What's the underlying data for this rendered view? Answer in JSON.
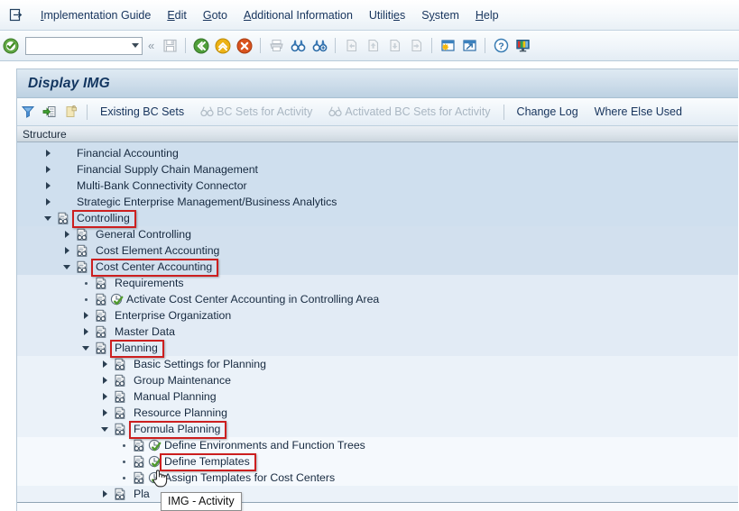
{
  "window": {
    "title": "Display IMG"
  },
  "menubar": {
    "system_icon": "sap-system-menu-icon",
    "items": [
      {
        "label": "Implementation Guide",
        "accel": "I"
      },
      {
        "label": "Edit",
        "accel": "E"
      },
      {
        "label": "Goto",
        "accel": "G"
      },
      {
        "label": "Additional Information",
        "accel": "A"
      },
      {
        "label": "Utilities",
        "accel": "e"
      },
      {
        "label": "System",
        "accel": "y"
      },
      {
        "label": "Help",
        "accel": "H"
      }
    ]
  },
  "toolbar": {
    "enter_icon": "green-check-enter-icon",
    "command_field": {
      "value": "",
      "placeholder": ""
    },
    "command_dropdown_icon": "chevron-down-icon",
    "collapse_icon": "double-chevron-left-icon",
    "buttons": [
      {
        "name": "save-button",
        "icon": "floppy-disk-icon",
        "enabled": false
      },
      {
        "name": "back-button",
        "icon": "green-back-arrow-icon",
        "enabled": true
      },
      {
        "name": "exit-button",
        "icon": "yellow-exit-up-arrow-icon",
        "enabled": true
      },
      {
        "name": "cancel-button",
        "icon": "red-cancel-x-icon",
        "enabled": true
      },
      {
        "name": "print-button",
        "icon": "printer-icon",
        "enabled": false
      },
      {
        "name": "find-button",
        "icon": "binoculars-icon",
        "enabled": true
      },
      {
        "name": "find-next-button",
        "icon": "binoculars-plus-icon",
        "enabled": true
      },
      {
        "name": "first-page-button",
        "icon": "page-first-icon",
        "enabled": false
      },
      {
        "name": "previous-page-button",
        "icon": "page-up-icon",
        "enabled": false
      },
      {
        "name": "next-page-button",
        "icon": "page-down-icon",
        "enabled": false
      },
      {
        "name": "last-page-button",
        "icon": "page-last-icon",
        "enabled": false
      },
      {
        "name": "create-session-button",
        "icon": "new-session-window-icon",
        "enabled": true
      },
      {
        "name": "create-shortcut-button",
        "icon": "shortcut-window-arrow-icon",
        "enabled": true
      },
      {
        "name": "help-button",
        "icon": "blue-question-help-icon",
        "enabled": true
      },
      {
        "name": "customize-layout-button",
        "icon": "local-layout-monitor-icon",
        "enabled": true
      }
    ]
  },
  "apptoolbar": {
    "icons": [
      {
        "name": "filter-funnel-button",
        "icon": "blue-funnel-icon",
        "enabled": true
      },
      {
        "name": "expand-node-button",
        "icon": "green-arrow-into-list-icon",
        "enabled": true
      },
      {
        "name": "note-button",
        "icon": "yellow-note-lock-icon",
        "enabled": false
      }
    ],
    "buttons": [
      {
        "label": "Existing BC Sets",
        "enabled": true
      },
      {
        "label": "BC Sets for Activity",
        "enabled": false,
        "icon": "bc-set-glasses-icon"
      },
      {
        "label": "Activated BC Sets for Activity",
        "enabled": false,
        "icon": "bc-set-glasses-icon"
      },
      {
        "label": "Change Log",
        "enabled": true
      },
      {
        "label": "Where Else Used",
        "enabled": true
      }
    ]
  },
  "tree": {
    "column_header": "Structure",
    "rows": [
      {
        "label": "Financial Accounting",
        "level": 1,
        "twisty": "right",
        "node_icon": "none",
        "activity_icon": "none",
        "highlight": false
      },
      {
        "label": "Financial Supply Chain Management",
        "level": 1,
        "twisty": "right",
        "node_icon": "none",
        "activity_icon": "none",
        "highlight": false
      },
      {
        "label": "Multi-Bank Connectivity Connector",
        "level": 1,
        "twisty": "right",
        "node_icon": "none",
        "activity_icon": "none",
        "highlight": false
      },
      {
        "label": "Strategic Enterprise Management/Business Analytics",
        "level": 1,
        "twisty": "right",
        "node_icon": "none",
        "activity_icon": "none",
        "highlight": false
      },
      {
        "label": "Controlling",
        "level": 1,
        "twisty": "down",
        "node_icon": "img-structure",
        "activity_icon": "none",
        "highlight": true
      },
      {
        "label": "General Controlling",
        "level": 2,
        "twisty": "right",
        "node_icon": "img-structure",
        "activity_icon": "none",
        "highlight": false
      },
      {
        "label": "Cost Element Accounting",
        "level": 2,
        "twisty": "right",
        "node_icon": "img-structure",
        "activity_icon": "none",
        "highlight": false
      },
      {
        "label": "Cost Center Accounting",
        "level": 2,
        "twisty": "down",
        "node_icon": "img-structure",
        "activity_icon": "none",
        "highlight": true
      },
      {
        "label": "Requirements",
        "level": 3,
        "twisty": "leaf",
        "node_icon": "img-structure",
        "activity_icon": "none",
        "highlight": false
      },
      {
        "label": "Activate Cost Center Accounting in Controlling Area",
        "level": 3,
        "twisty": "leaf",
        "node_icon": "img-structure",
        "activity_icon": "img-activity-clock-check",
        "highlight": false
      },
      {
        "label": "Enterprise Organization",
        "level": 3,
        "twisty": "right",
        "node_icon": "img-structure",
        "activity_icon": "none",
        "highlight": false
      },
      {
        "label": "Master Data",
        "level": 3,
        "twisty": "right",
        "node_icon": "img-structure",
        "activity_icon": "none",
        "highlight": false
      },
      {
        "label": "Planning",
        "level": 3,
        "twisty": "down",
        "node_icon": "img-structure",
        "activity_icon": "none",
        "highlight": true
      },
      {
        "label": "Basic Settings for Planning",
        "level": 4,
        "twisty": "right",
        "node_icon": "img-structure",
        "activity_icon": "none",
        "highlight": false
      },
      {
        "label": "Group Maintenance",
        "level": 4,
        "twisty": "right",
        "node_icon": "img-structure",
        "activity_icon": "none",
        "highlight": false
      },
      {
        "label": "Manual Planning",
        "level": 4,
        "twisty": "right",
        "node_icon": "img-structure",
        "activity_icon": "none",
        "highlight": false
      },
      {
        "label": "Resource Planning",
        "level": 4,
        "twisty": "right",
        "node_icon": "img-structure",
        "activity_icon": "none",
        "highlight": false
      },
      {
        "label": "Formula Planning",
        "level": 4,
        "twisty": "down",
        "node_icon": "img-structure",
        "activity_icon": "none",
        "highlight": true
      },
      {
        "label": "Define Environments and Function Trees",
        "level": 5,
        "twisty": "leaf",
        "node_icon": "img-structure",
        "activity_icon": "img-activity-clock-check",
        "highlight": false
      },
      {
        "label": "Define Templates",
        "level": 5,
        "twisty": "leaf",
        "node_icon": "img-structure",
        "activity_icon": "img-activity-clock-check",
        "highlight": true
      },
      {
        "label": "Assign Templates for Cost Centers",
        "level": 5,
        "twisty": "leaf",
        "node_icon": "img-structure",
        "activity_icon": "img-activity-clock-check",
        "highlight": false
      },
      {
        "label": "Pla",
        "level": 4,
        "twisty": "right",
        "node_icon": "img-structure",
        "activity_icon": "none",
        "highlight": false
      }
    ]
  },
  "tooltip": {
    "text": "IMG - Activity"
  },
  "cursor": {
    "icon": "pointing-hand-cursor"
  },
  "colors": {
    "annotation": "#cc1f1f",
    "title_text": "#12355f",
    "menu_text": "#16335c",
    "band_l1": "#cfdfee",
    "band_l2": "#d2e0ee",
    "band_l3": "#e2ebf5",
    "band_l4": "#ebf2f9",
    "band_l5": "#f5f9fd"
  }
}
